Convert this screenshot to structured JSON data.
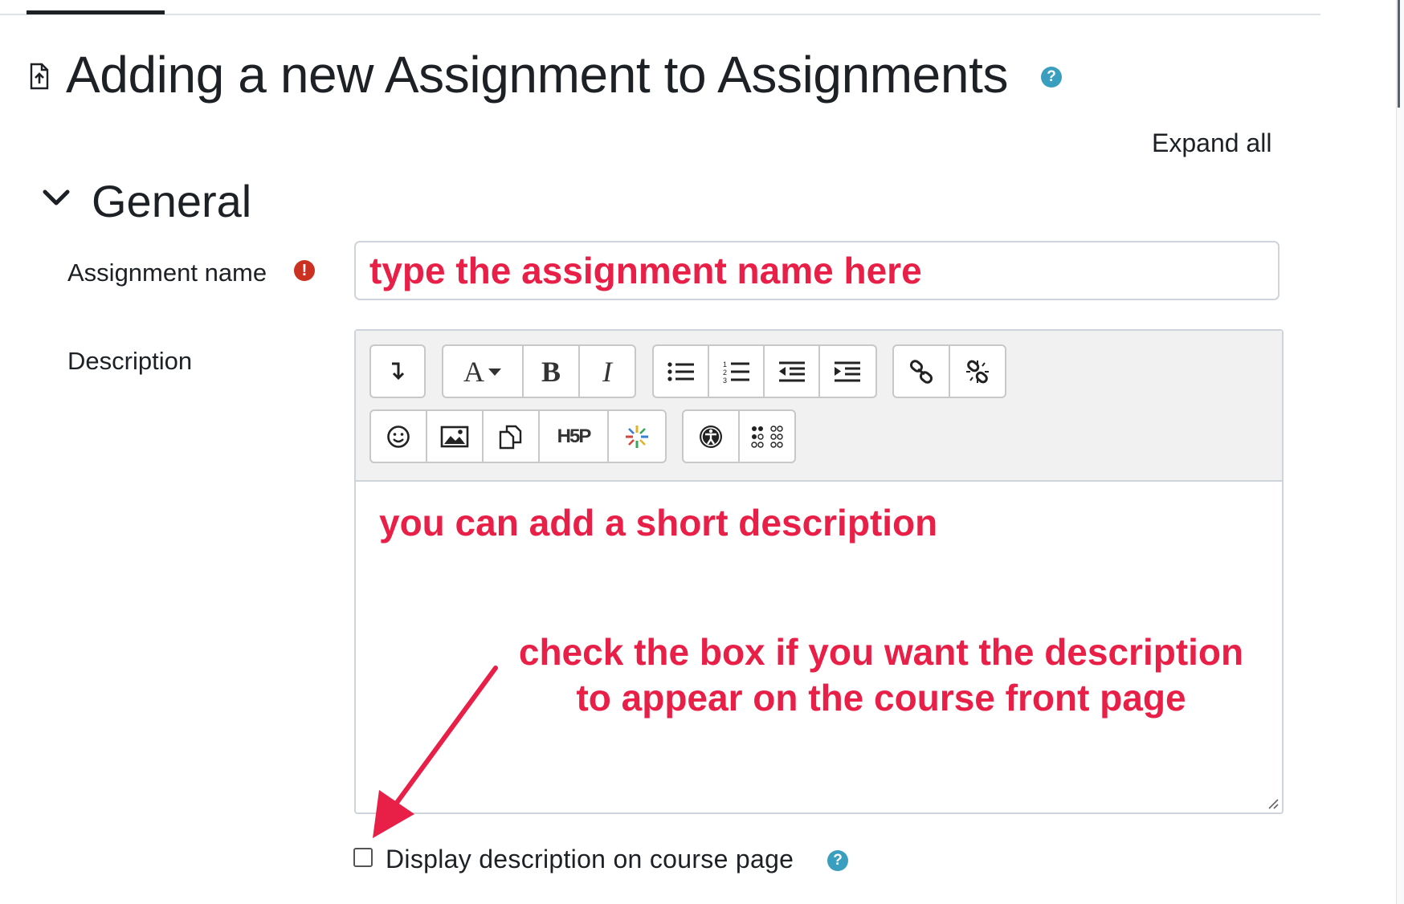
{
  "page": {
    "title": "Adding a new Assignment to Assignments",
    "expand_all": "Expand all"
  },
  "icons": {
    "page": "document-upload-icon",
    "title_help": "help-icon",
    "required": "required-icon",
    "collapse": "chevron-down-icon"
  },
  "general": {
    "section_title": "General",
    "assignment_name": {
      "label": "Assignment name",
      "value": "type the assignment name here"
    },
    "description": {
      "label": "Description",
      "content": "you can add a short description",
      "toolbar_row1": [
        "show-more-buttons",
        "font-style",
        "bold",
        "italic",
        "bullet-list",
        "numbered-list",
        "outdent",
        "indent",
        "link",
        "unlink"
      ],
      "toolbar_row2": [
        "emoji",
        "image",
        "media",
        "h5p",
        "ai-sparkle",
        "accessibility-checker",
        "braille"
      ],
      "toolbar_labels": {
        "font": "A",
        "bold": "B",
        "italic": "I",
        "h5p": "H5P"
      }
    },
    "display_description": {
      "label": "Display description on course page",
      "checked": false
    }
  },
  "annotation": {
    "note": "check the box if you want the description to appear on the course front page",
    "color": "#e82048"
  },
  "colors": {
    "annotation_red": "#e82048",
    "help_blue": "#3a9fbf",
    "required_red": "#ca3120"
  }
}
